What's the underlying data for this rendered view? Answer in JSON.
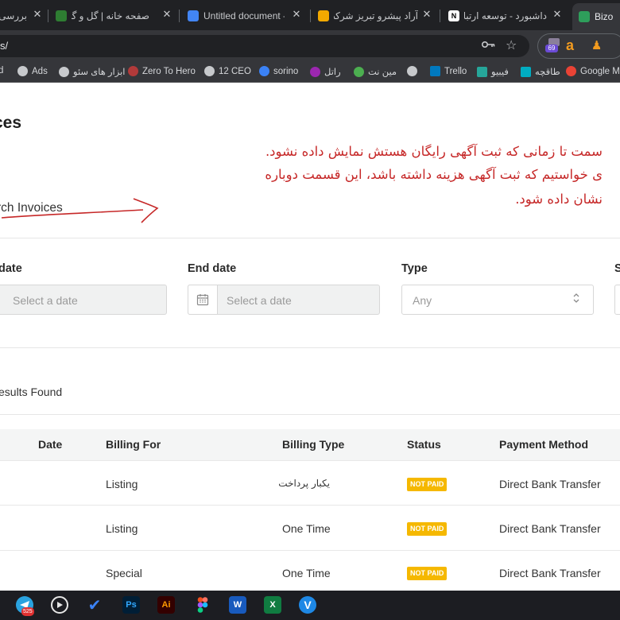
{
  "browser": {
    "tabs": [
      {
        "title": "بررسی"
      },
      {
        "title": "صفحه خانه | گل و گیاه آپشا"
      },
      {
        "title": "Untitled document -"
      },
      {
        "title": "آراد پیشرو تبریز شرکت تو"
      },
      {
        "title": "داشبورد - توسعه ارتباطات"
      },
      {
        "title": "Bizo"
      }
    ],
    "tab_close_glyph": "✕",
    "address": "s/",
    "extension_badge": "69",
    "extension_letter": "a",
    "bookmarks": [
      {
        "label": "d"
      },
      {
        "label": "Ads"
      },
      {
        "label": "ابزار های سئو"
      },
      {
        "label": "Zero To Hero"
      },
      {
        "label": "12 CEO"
      },
      {
        "label": "sorino"
      },
      {
        "label": "راتل"
      },
      {
        "label": "مین نت"
      },
      {
        "label": ""
      },
      {
        "label": "Trello"
      },
      {
        "label": "فیبیو"
      },
      {
        "label": "طاقچه"
      },
      {
        "label": "Google M"
      }
    ]
  },
  "page": {
    "title": "ces",
    "annotation": {
      "line1": "سمت تا زمانی که ثبت آگهی رایگان هستش نمایش داده نشود.",
      "line2": "ی خواستیم که ثبت آگهی هزینه داشته باشد، این قسمت دوباره",
      "line3": "نشان داده شود."
    },
    "search_label": "rch Invoices",
    "filters": {
      "start_label": "date",
      "start_placeholder": "Select a date",
      "end_label": "End date",
      "end_placeholder": "Select a date",
      "type_label": "Type",
      "type_value": "Any",
      "fourth_label": "S"
    },
    "results_text": "esults Found",
    "table": {
      "headers": {
        "date": "Date",
        "billing_for": "Billing For",
        "billing_type": "Billing Type",
        "status": "Status",
        "payment_method": "Payment Method"
      },
      "rows": [
        {
          "billing_for": "Listing",
          "billing_type": "یکبار پرداخت",
          "status": "NOT PAID",
          "payment_method": "Direct Bank Transfer"
        },
        {
          "billing_for": "Listing",
          "billing_type": "One Time",
          "status": "NOT PAID",
          "payment_method": "Direct Bank Transfer"
        },
        {
          "billing_for": "Special",
          "billing_type": "One Time",
          "status": "NOT PAID",
          "payment_method": "Direct Bank Transfer"
        }
      ]
    }
  },
  "taskbar": {
    "telegram_badge": "525",
    "apps": [
      "telegram",
      "media-player",
      "tasks",
      "Ps",
      "Ai",
      "figma",
      "W",
      "X",
      "vpn"
    ]
  },
  "colors": {
    "annotation_red": "#c62828",
    "badge_yellow": "#f5b800",
    "chrome_dark": "#202124"
  }
}
